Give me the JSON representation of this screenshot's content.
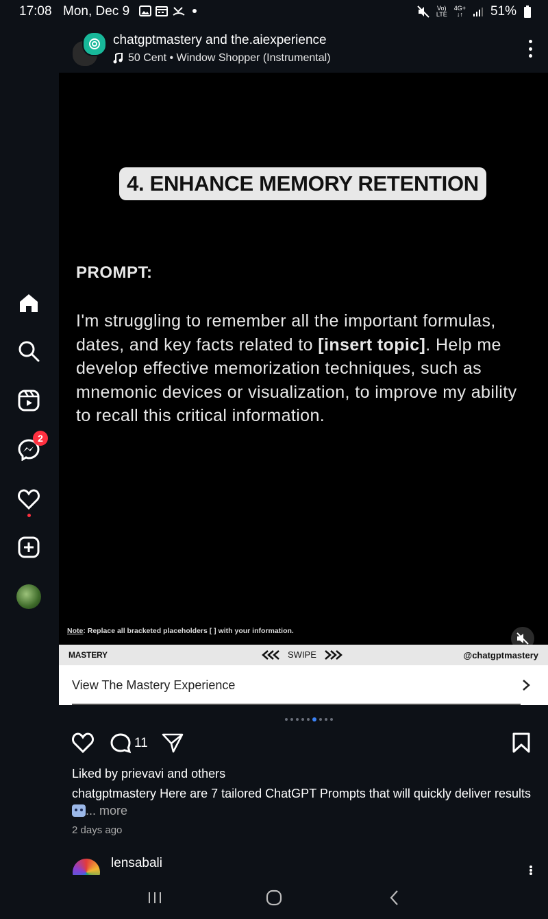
{
  "status_bar": {
    "time": "17:08",
    "date": "Mon, Dec 9",
    "signal_label_top": "Vo)",
    "signal_label_bottom": "LTE",
    "network_top": "4G+",
    "network_bottom": "↓↑",
    "battery": "51%"
  },
  "sidebar": {
    "messages_badge": "2"
  },
  "post": {
    "authors": "chatgptmastery and the.aiexperience",
    "music": "50 Cent • Window Shopper (Instrumental)",
    "slide": {
      "title": "4. ENHANCE MEMORY RETENTION",
      "prompt_label": "PROMPT:",
      "prompt_part1": "I'm struggling to remember all the important formulas, dates, and key facts related to ",
      "prompt_bold": "[insert topic]",
      "prompt_part2": ". Help me develop effective memorization techniques, such as mnemonic devices or visualization, to improve my ability to recall this critical information.",
      "note_label": "Note",
      "note_text": ": Replace all bracketed placeholders [ ] with your information.",
      "footer_brand": "MASTERY",
      "footer_swipe": "SWIPE",
      "footer_handle": "@chatgptmastery"
    },
    "cta": "View The Mastery Experience",
    "carousel": {
      "count": 9,
      "active_index": 5
    },
    "comments_count": "11",
    "likes": "Liked by prievavi and others",
    "caption_user": "chatgptmastery",
    "caption_text": "Here are 7 tailored ChatGPT Prompts that will quickly deliver results",
    "caption_more": "... more",
    "posted": "2 days ago"
  },
  "next_post": {
    "username": "lensabali"
  },
  "colors": {
    "background": "#0d1117",
    "badge": "#ff3040",
    "active_dot": "#3b82f6"
  }
}
